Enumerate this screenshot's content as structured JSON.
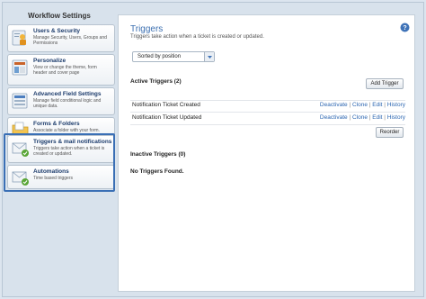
{
  "sidebar": {
    "title": "Workflow Settings",
    "items": [
      {
        "label": "Users & Security",
        "desc": "Manage Security, Users, Groups and Permissions",
        "icon": "users-icon"
      },
      {
        "label": "Personalize",
        "desc": "View or change the theme, form header and cover page",
        "icon": "personalize-icon"
      },
      {
        "label": "Advanced Field Settings",
        "desc": "Manage field conditional logic and unique data.",
        "icon": "advanced-fields-icon"
      },
      {
        "label": "Forms & Folders",
        "desc": "Associate a folder with your form.",
        "icon": "forms-folders-icon"
      },
      {
        "label": "Triggers & mail notifications",
        "desc": "Triggers take action when a ticket is created or updated.",
        "icon": "triggers-icon"
      },
      {
        "label": "Automations",
        "desc": "Time based triggers",
        "icon": "automations-icon"
      }
    ]
  },
  "main": {
    "title": "Triggers",
    "subtitle": "Triggers take action when a ticket is created or updated.",
    "help_icon": "help-icon",
    "sort": {
      "selected": "Sorted by position"
    },
    "active": {
      "label": "Active Triggers (2)",
      "add_button": "Add Trigger",
      "rows": [
        {
          "name": "Notification Ticket Created",
          "actions": [
            "Deactivate",
            "Clone",
            "Edit",
            "History"
          ]
        },
        {
          "name": "Notification Ticket Updated",
          "actions": [
            "Deactivate",
            "Clone",
            "Edit",
            "History"
          ]
        }
      ],
      "reorder_button": "Reorder"
    },
    "inactive": {
      "label": "Inactive Triggers (0)",
      "empty": "No Triggers Found."
    }
  },
  "colors": {
    "accent": "#3c6fb0",
    "link": "#2d67b2",
    "selected_border": "#3a6fb5"
  }
}
